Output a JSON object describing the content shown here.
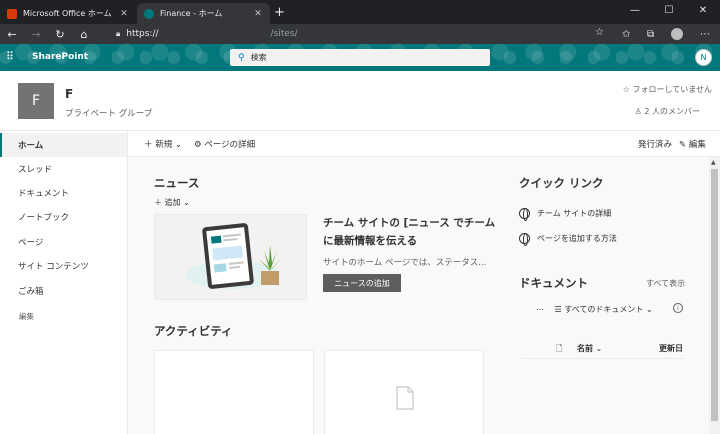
{
  "browser": {
    "tabs": [
      {
        "title": "Microsoft Office ホーム"
      },
      {
        "title": "Finance - ホーム"
      }
    ],
    "new_tab": "+",
    "url_host": "https://",
    "url_path": "/sites/"
  },
  "suite": {
    "app_name": "SharePoint",
    "search_placeholder": "検索",
    "me_initial": "N"
  },
  "site": {
    "logo_letter": "F",
    "name": "F",
    "subtitle": "プライベート グループ",
    "follow": "フォローしていません",
    "members": "2 人のメンバー"
  },
  "nav": {
    "items": [
      {
        "label": "ホーム",
        "selected": true
      },
      {
        "label": "スレッド"
      },
      {
        "label": "ドキュメント"
      },
      {
        "label": "ノートブック"
      },
      {
        "label": "ページ"
      },
      {
        "label": "サイト コンテンツ"
      },
      {
        "label": "ごみ箱"
      }
    ],
    "edit": "編集"
  },
  "commands": {
    "new": "新規",
    "page_details": "ページの詳細",
    "published": "発行済み",
    "edit": "編集"
  },
  "news": {
    "heading": "ニュース",
    "add": "追加",
    "title": "チーム サイトの [ニュース でチームに最新情報を伝える",
    "desc": "サイトのホーム ページでは、ステータス...",
    "button": "ニュースの追加"
  },
  "activity": {
    "heading": "アクティビティ"
  },
  "quicklinks": {
    "heading": "クイック リンク",
    "items": [
      {
        "label": "チーム サイトの詳細"
      },
      {
        "label": "ページを追加する方法"
      }
    ]
  },
  "documents": {
    "heading": "ドキュメント",
    "show_all": "すべて表示",
    "filter": "すべてのドキュメント",
    "col_name": "名前",
    "col_modified": "更新日"
  },
  "colors": {
    "suite_bar": "#03787c",
    "button": "#605e5c"
  }
}
